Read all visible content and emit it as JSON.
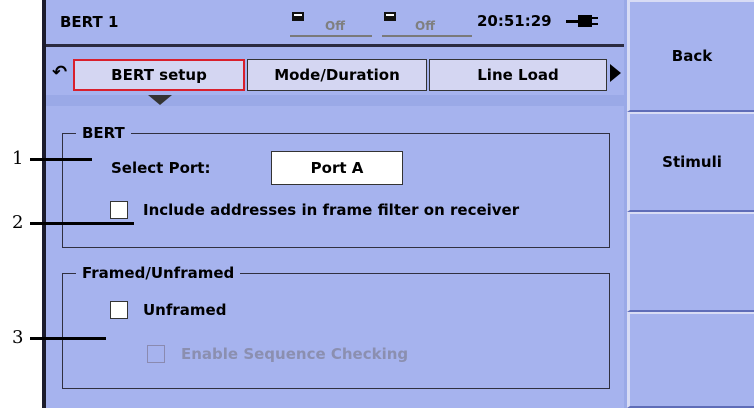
{
  "status": {
    "title": "BERT 1",
    "led1_text": "Off",
    "led2_text": "Off",
    "clock": "20:51:29"
  },
  "tabs": [
    {
      "label": "BERT setup",
      "active": true
    },
    {
      "label": "Mode/Duration",
      "active": false
    },
    {
      "label": "Line Load",
      "active": false
    }
  ],
  "bert_group": {
    "title": "BERT",
    "select_port_label": "Select Port:",
    "port_value": "Port A",
    "include_addresses_label": "Include addresses in frame filter on receiver",
    "include_addresses_checked": false
  },
  "framing_group": {
    "title": "Framed/Unframed",
    "unframed_label": "Unframed",
    "unframed_checked": false,
    "sequence_label": "Enable Sequence Checking",
    "sequence_enabled": false
  },
  "softkeys": [
    {
      "label": "Back"
    },
    {
      "label": "Stimuli"
    },
    {
      "label": ""
    },
    {
      "label": ""
    }
  ],
  "callouts": [
    "1",
    "2",
    "3"
  ],
  "colors": {
    "screen_bg": "#a6b3ee",
    "softkey_bg": "#a6b3ee",
    "active_tab_border": "#d9202c",
    "tab_bg": "#d4d6f2"
  }
}
